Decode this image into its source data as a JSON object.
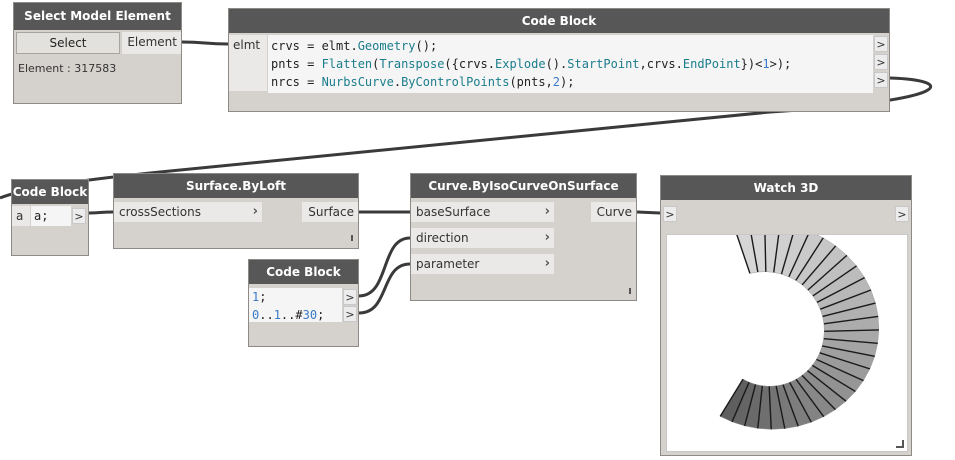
{
  "nodes": {
    "select": {
      "title": "Select Model Element",
      "button": "Select",
      "output": "Element",
      "info": "Element : 317583"
    },
    "code_main": {
      "title": "Code Block",
      "input": "elmt",
      "lines": [
        [
          {
            "t": "crvs = elmt.",
            "c": "p"
          },
          {
            "t": "Geometry",
            "c": "k"
          },
          {
            "t": "();",
            "c": "p"
          }
        ],
        [
          {
            "t": "pnts = ",
            "c": "p"
          },
          {
            "t": "Flatten",
            "c": "k"
          },
          {
            "t": "(",
            "c": "p"
          },
          {
            "t": "Transpose",
            "c": "k"
          },
          {
            "t": "({crvs.",
            "c": "p"
          },
          {
            "t": "Explode",
            "c": "k"
          },
          {
            "t": "().",
            "c": "p"
          },
          {
            "t": "StartPoint",
            "c": "k"
          },
          {
            "t": ",crvs.",
            "c": "p"
          },
          {
            "t": "EndPoint",
            "c": "k"
          },
          {
            "t": "})<",
            "c": "p"
          },
          {
            "t": "1",
            "c": "n"
          },
          {
            "t": ">);",
            "c": "p"
          }
        ],
        [
          {
            "t": "nrcs = ",
            "c": "p"
          },
          {
            "t": "NurbsCurve",
            "c": "k"
          },
          {
            "t": ".",
            "c": "p"
          },
          {
            "t": "ByControlPoints",
            "c": "k"
          },
          {
            "t": "(pnts,",
            "c": "p"
          },
          {
            "t": "2",
            "c": "n"
          },
          {
            "t": ");",
            "c": "p"
          }
        ]
      ],
      "out_glyph": ">"
    },
    "code_a": {
      "title": "Code Block",
      "input": "a",
      "code": "a;",
      "out_glyph": ">"
    },
    "loft": {
      "title": "Surface.ByLoft",
      "input": "crossSections",
      "output": "Surface"
    },
    "code_params": {
      "title": "Code Block",
      "lines": [
        [
          {
            "t": "1",
            "c": "n"
          },
          {
            "t": ";",
            "c": "p"
          }
        ],
        [
          {
            "t": "0",
            "c": "n"
          },
          {
            "t": "..",
            "c": "p"
          },
          {
            "t": "1",
            "c": "n"
          },
          {
            "t": "..#",
            "c": "p"
          },
          {
            "t": "30",
            "c": "n"
          },
          {
            "t": ";",
            "c": "p"
          }
        ]
      ],
      "out_glyph": ">"
    },
    "iso": {
      "title": "Curve.ByIsoCurveOnSurface",
      "inputs": [
        "baseSurface",
        "direction",
        "parameter"
      ],
      "output": "Curve"
    },
    "watch": {
      "title": "Watch 3D",
      "in_glyph": ">",
      "out_glyph": ">"
    }
  },
  "colors": {
    "header": "#575757",
    "node_body": "#d5d2ce",
    "wire": "#3a3a3a",
    "keyword": "#1b7d8c",
    "number": "#3a7ac8",
    "surface_dark": "#5a5a5a",
    "surface_light": "#d6d6d6"
  },
  "icons": [
    "chevron-right-icon",
    "resize-grip-icon",
    "lacing-icon"
  ]
}
